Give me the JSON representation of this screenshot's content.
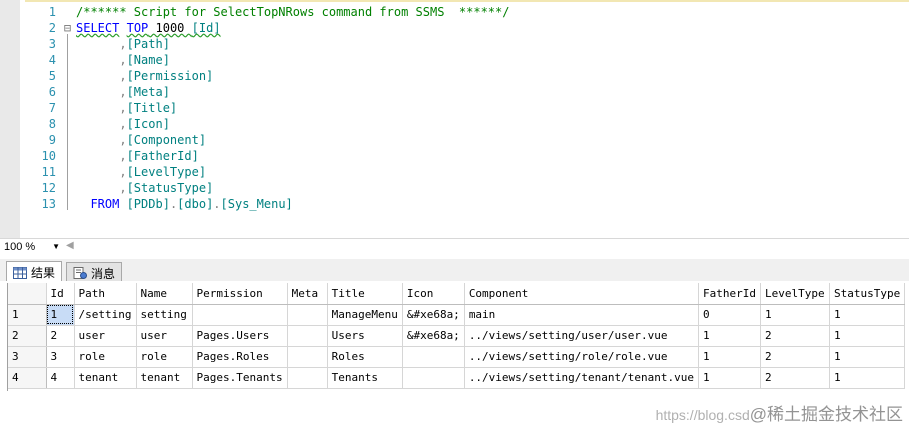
{
  "editor": {
    "lines": [
      {
        "n": "1",
        "parts": [
          {
            "t": "/****** Script for SelectTopNRows command from SSMS  ******/",
            "c": "c-com"
          }
        ],
        "fold": ""
      },
      {
        "n": "2",
        "parts": [
          {
            "t": "SELECT",
            "c": "c-key squiggle"
          },
          {
            "t": " ",
            "c": ""
          },
          {
            "t": "TOP",
            "c": "c-key squiggle"
          },
          {
            "t": " 1000 ",
            "c": "c-num squiggle"
          },
          {
            "t": "[Id]",
            "c": "c-ident squiggle"
          }
        ],
        "fold": "⊟"
      },
      {
        "n": "3",
        "parts": [
          {
            "t": "      ,",
            "c": "c-gray"
          },
          {
            "t": "[Path]",
            "c": "c-ident"
          }
        ],
        "fold": ""
      },
      {
        "n": "4",
        "parts": [
          {
            "t": "      ,",
            "c": "c-gray"
          },
          {
            "t": "[Name]",
            "c": "c-ident"
          }
        ],
        "fold": ""
      },
      {
        "n": "5",
        "parts": [
          {
            "t": "      ,",
            "c": "c-gray"
          },
          {
            "t": "[Permission]",
            "c": "c-ident"
          }
        ],
        "fold": ""
      },
      {
        "n": "6",
        "parts": [
          {
            "t": "      ,",
            "c": "c-gray"
          },
          {
            "t": "[Meta]",
            "c": "c-ident"
          }
        ],
        "fold": ""
      },
      {
        "n": "7",
        "parts": [
          {
            "t": "      ,",
            "c": "c-gray"
          },
          {
            "t": "[Title]",
            "c": "c-ident"
          }
        ],
        "fold": ""
      },
      {
        "n": "8",
        "parts": [
          {
            "t": "      ,",
            "c": "c-gray"
          },
          {
            "t": "[Icon]",
            "c": "c-ident"
          }
        ],
        "fold": ""
      },
      {
        "n": "9",
        "parts": [
          {
            "t": "      ,",
            "c": "c-gray"
          },
          {
            "t": "[Component]",
            "c": "c-ident"
          }
        ],
        "fold": ""
      },
      {
        "n": "10",
        "parts": [
          {
            "t": "      ,",
            "c": "c-gray"
          },
          {
            "t": "[FatherId]",
            "c": "c-ident"
          }
        ],
        "fold": ""
      },
      {
        "n": "11",
        "parts": [
          {
            "t": "      ,",
            "c": "c-gray"
          },
          {
            "t": "[LevelType]",
            "c": "c-ident"
          }
        ],
        "fold": ""
      },
      {
        "n": "12",
        "parts": [
          {
            "t": "      ,",
            "c": "c-gray"
          },
          {
            "t": "[StatusType]",
            "c": "c-ident"
          }
        ],
        "fold": ""
      },
      {
        "n": "13",
        "parts": [
          {
            "t": "  FROM ",
            "c": "c-key"
          },
          {
            "t": "[PDDb]",
            "c": "c-ident"
          },
          {
            "t": ".",
            "c": "c-gray"
          },
          {
            "t": "[dbo]",
            "c": "c-ident"
          },
          {
            "t": ".",
            "c": "c-gray"
          },
          {
            "t": "[Sys_Menu]",
            "c": "c-ident"
          }
        ],
        "fold": ""
      }
    ]
  },
  "zoom": {
    "value": "100 %"
  },
  "tabs": {
    "results": {
      "label": "结果",
      "icon": "grid-icon"
    },
    "messages": {
      "label": "消息",
      "icon": "messages-icon"
    }
  },
  "grid": {
    "columns": [
      "Id",
      "Path",
      "Name",
      "Permission",
      "Meta",
      "Title",
      "Icon",
      "Component",
      "FatherId",
      "LevelType",
      "StatusType"
    ],
    "rows": [
      {
        "num": "1",
        "cells": [
          "1",
          "/setting",
          "setting",
          "",
          "",
          "ManageMenu",
          "&#xe68a;",
          "main",
          "0",
          "1",
          "1"
        ]
      },
      {
        "num": "2",
        "cells": [
          "2",
          "user",
          "user",
          "Pages.Users",
          "",
          "Users",
          "&#xe68a;",
          "../views/setting/user/user.vue",
          "1",
          "2",
          "1"
        ]
      },
      {
        "num": "3",
        "cells": [
          "3",
          "role",
          "role",
          "Pages.Roles",
          "",
          "Roles",
          "",
          "../views/setting/role/role.vue",
          "1",
          "2",
          "1"
        ]
      },
      {
        "num": "4",
        "cells": [
          "4",
          "tenant",
          "tenant",
          "Pages.Tenants",
          "",
          "Tenants",
          "",
          "../views/setting/tenant/tenant.vue",
          "1",
          "2",
          "1"
        ]
      }
    ],
    "selected_cell": {
      "row": 0,
      "col": 0
    }
  },
  "watermark": {
    "url": "https://blog.csd",
    "text": "@稀土掘金技术社区"
  },
  "colors": {
    "keyword": "#0000ff",
    "identifier": "#008080",
    "comment": "#008000",
    "line_number": "#2b91af",
    "selection": "#c8dcf6"
  }
}
